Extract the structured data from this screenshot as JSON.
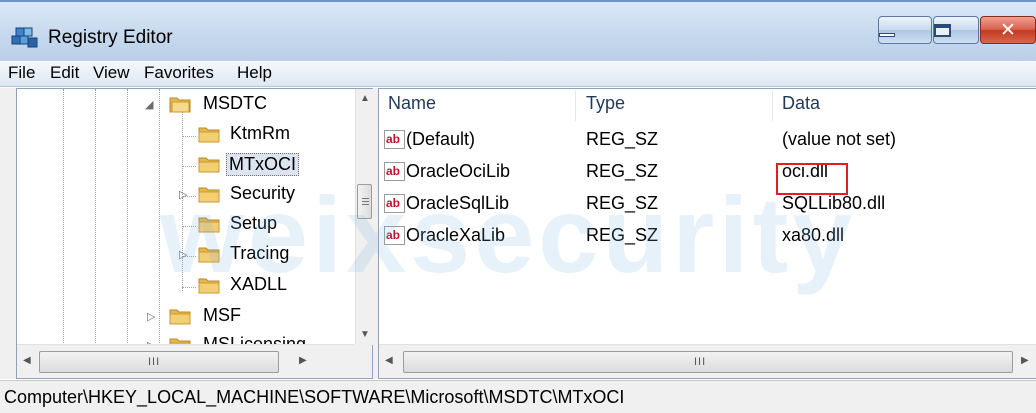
{
  "window": {
    "title": "Registry Editor"
  },
  "menu": [
    "File",
    "Edit",
    "View",
    "Favorites",
    "Help"
  ],
  "tree": {
    "items": [
      {
        "label": "MSDTC",
        "expander": "◢",
        "expanded": true
      },
      {
        "label": "KtmRm",
        "expander": ""
      },
      {
        "label": "MTxOCI",
        "expander": "",
        "selected": true
      },
      {
        "label": "Security",
        "expander": "▷"
      },
      {
        "label": "Setup",
        "expander": ""
      },
      {
        "label": "Tracing",
        "expander": "▷"
      },
      {
        "label": "XADLL",
        "expander": ""
      },
      {
        "label": "MSF",
        "expander": "▷"
      },
      {
        "label": "MSLicensing",
        "expander": "▷"
      }
    ]
  },
  "list": {
    "headers": {
      "name": "Name",
      "type": "Type",
      "data": "Data"
    },
    "rows": [
      {
        "name": "(Default)",
        "type": "REG_SZ",
        "data": "(value not set)"
      },
      {
        "name": "OracleOciLib",
        "type": "REG_SZ",
        "data": "oci.dll"
      },
      {
        "name": "OracleSqlLib",
        "type": "REG_SZ",
        "data": "SQLLib80.dll"
      },
      {
        "name": "OracleXaLib",
        "type": "REG_SZ",
        "data": "xa80.dll"
      }
    ],
    "icon_text": "ab"
  },
  "status": {
    "path": "Computer\\HKEY_LOCAL_MACHINE\\SOFTWARE\\Microsoft\\MSDTC\\MTxOCI"
  },
  "watermark": "weixsecurity",
  "scroll": {
    "grip": "III"
  },
  "colors": {
    "highlight": "#e02020",
    "selection": "#dbe4ef",
    "folder": "#e6b84a"
  }
}
